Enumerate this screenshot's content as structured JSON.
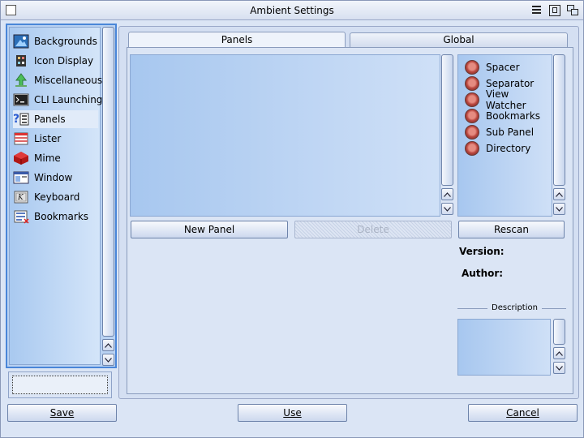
{
  "window": {
    "title": "Ambient Settings"
  },
  "sidebar": {
    "items": [
      {
        "label": "Backgrounds",
        "icon": "backgrounds-icon"
      },
      {
        "label": "Icon Display",
        "icon": "icon-display-icon"
      },
      {
        "label": "Miscellaneous",
        "icon": "miscellaneous-icon"
      },
      {
        "label": "CLI Launching",
        "icon": "cli-launching-icon"
      },
      {
        "label": "Panels",
        "icon": "panels-icon",
        "selected": true
      },
      {
        "label": "Lister",
        "icon": "lister-icon"
      },
      {
        "label": "Mime",
        "icon": "mime-icon"
      },
      {
        "label": "Window",
        "icon": "window-icon"
      },
      {
        "label": "Keyboard",
        "icon": "keyboard-icon"
      },
      {
        "label": "Bookmarks",
        "icon": "bookmarks-icon"
      }
    ]
  },
  "tabs": [
    {
      "label": "Panels",
      "active": true
    },
    {
      "label": "Global",
      "active": false
    }
  ],
  "panels": {
    "new_panel": "New Panel",
    "delete": "Delete",
    "rescan": "Rescan",
    "modules": [
      "Spacer",
      "Separator",
      "View Watcher",
      "Bookmarks",
      "Sub Panel",
      "Directory"
    ],
    "version_label": "Version:",
    "author_label": "Author:",
    "description_label": "Description"
  },
  "footer": {
    "save": "Save",
    "use": "Use",
    "cancel": "Cancel"
  },
  "colors": {
    "accent": "#4a86d8",
    "list_bg": "#b9d2f2",
    "window_bg": "#dbe5f5",
    "module_dot": "#b8453d"
  }
}
